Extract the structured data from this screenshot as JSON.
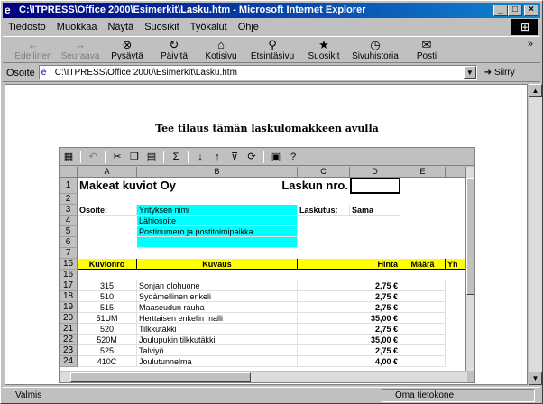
{
  "window": {
    "title": "C:\\ITPRESS\\Office 2000\\Esimerkit\\Lasku.htm - Microsoft Internet Explorer"
  },
  "menu": [
    "Tiedosto",
    "Muokkaa",
    "Näytä",
    "Suosikit",
    "Työkalut",
    "Ohje"
  ],
  "toolbar": {
    "buttons": [
      {
        "label": "Edellinen",
        "icon": "back-arrow-icon",
        "disabled": true
      },
      {
        "label": "Seuraava",
        "icon": "forward-arrow-icon",
        "disabled": true
      },
      {
        "label": "Pysäytä",
        "icon": "stop-icon",
        "disabled": false
      },
      {
        "label": "Päivitä",
        "icon": "refresh-icon",
        "disabled": false
      },
      {
        "label": "Kotisivu",
        "icon": "home-icon",
        "disabled": false
      },
      {
        "label": "Etsintäsivu",
        "icon": "search-icon",
        "disabled": false
      },
      {
        "label": "Suosikit",
        "icon": "favorites-icon",
        "disabled": false
      },
      {
        "label": "Sivuhistoria",
        "icon": "history-icon",
        "disabled": false
      },
      {
        "label": "Posti",
        "icon": "mail-icon",
        "disabled": false
      }
    ]
  },
  "address": {
    "label": "Osoite",
    "value": "C:\\ITPRESS\\Office 2000\\Esimerkit\\Lasku.htm",
    "go_label": "Siirry"
  },
  "page": {
    "heading": "Tee tilaus tämän laskulomakkeen avulla"
  },
  "sheet": {
    "columns": [
      "A",
      "B",
      "C",
      "D",
      "E"
    ],
    "company": "Makeat kuviot Oy",
    "invoice_label": "Laskun nro.",
    "address_label": "Osoite:",
    "address_fields": [
      "Yrityksen nimi",
      "Lähiosoite",
      "Postinumero ja postitoimipaikka"
    ],
    "billing_label": "Laskutus:",
    "billing_value": "Sama",
    "headers": [
      "Kuvionro",
      "Kuvaus",
      "Hinta",
      "Määrä",
      "Yh"
    ],
    "rows": [
      {
        "row": "17",
        "code": "315",
        "desc": "Sonjan olohuone",
        "price": "2,75 €"
      },
      {
        "row": "18",
        "code": "510",
        "desc": "Sydämellinen enkeli",
        "price": "2,75 €"
      },
      {
        "row": "19",
        "code": "515",
        "desc": "Maaseudun rauha",
        "price": "2,75 €"
      },
      {
        "row": "20",
        "code": "51UM",
        "desc": "Herttaisen enkelin malli",
        "price": "35,00 €"
      },
      {
        "row": "21",
        "code": "520",
        "desc": "Tilkkutäkki",
        "price": "2,75 €"
      },
      {
        "row": "22",
        "code": "520M",
        "desc": "Joulupukin tilkkutäkki",
        "price": "35,00 €"
      },
      {
        "row": "23",
        "code": "525",
        "desc": "Talviyö",
        "price": "2,75 €"
      },
      {
        "row": "24",
        "code": "410C",
        "desc": "Joulutunnelma",
        "price": "4,00 €"
      }
    ]
  },
  "status": {
    "text": "Valmis",
    "zone": "Oma tietokone"
  }
}
